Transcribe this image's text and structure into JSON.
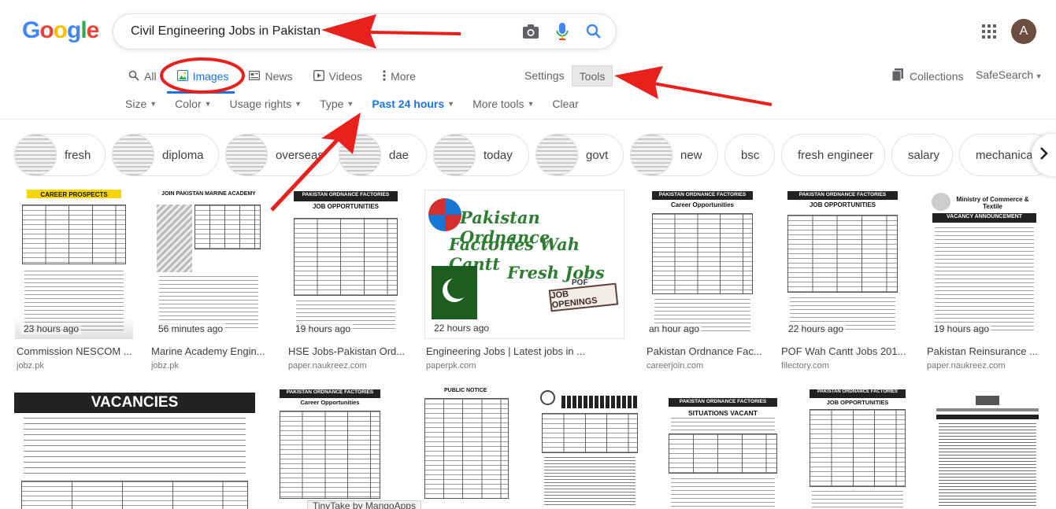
{
  "logo": {
    "letters": [
      "G",
      "o",
      "o",
      "g",
      "l",
      "e"
    ]
  },
  "search": {
    "query": "Civil Engineering Jobs in Pakistan"
  },
  "icons": {
    "camera": "camera-icon",
    "mic": "mic-icon",
    "search": "search-icon",
    "apps": "apps-grid-icon"
  },
  "account": {
    "initial": "A",
    "color": "#6d4c41"
  },
  "tabs": [
    {
      "label": "All",
      "icon": "search-icon"
    },
    {
      "label": "Images",
      "icon": "image-icon"
    },
    {
      "label": "News",
      "icon": "news-icon"
    },
    {
      "label": "Videos",
      "icon": "video-icon"
    },
    {
      "label": "More",
      "icon": "more-vert-icon"
    }
  ],
  "toolbar": {
    "settings": "Settings",
    "tools": "Tools",
    "collections": "Collections",
    "safesearch": "SafeSearch"
  },
  "filters": [
    {
      "label": "Size"
    },
    {
      "label": "Color"
    },
    {
      "label": "Usage rights"
    },
    {
      "label": "Type"
    },
    {
      "label": "Past 24 hours"
    },
    {
      "label": "More tools"
    },
    {
      "label": "Clear"
    }
  ],
  "chips": [
    {
      "label": "fresh"
    },
    {
      "label": "diploma"
    },
    {
      "label": "overseas"
    },
    {
      "label": "dae"
    },
    {
      "label": "today"
    },
    {
      "label": "govt"
    },
    {
      "label": "new"
    },
    {
      "label": "bsc"
    },
    {
      "label": "fresh engineer"
    },
    {
      "label": "salary"
    },
    {
      "label": "mechanical"
    }
  ],
  "results_row1": [
    {
      "time": "23 hours ago",
      "title": "Commission NESCOM ...",
      "source": "jobz.pk",
      "head": "CAREER PROSPECTS"
    },
    {
      "time": "56 minutes ago",
      "title": "Marine Academy Engin...",
      "source": "jobz.pk",
      "head": "JOIN PAKISTAN MARINE ACADEMY"
    },
    {
      "time": "19 hours ago",
      "title": "HSE Jobs-Pakistan Ord...",
      "source": "paper.naukreez.com",
      "head": "PAKISTAN ORDNANCE FACTORIES",
      "sub": "JOB OPPORTUNITIES"
    },
    {
      "time": "22 hours ago",
      "title": "Engineering Jobs | Latest jobs in ...",
      "source": "paperpk.com",
      "overlay": [
        "Pakistan Ordnance",
        "Factories Wah Cantt",
        "Fresh Jobs"
      ],
      "sign": "JOB OPENINGS",
      "pof": "POF"
    },
    {
      "time": "an hour ago",
      "title": "Pakistan Ordnance Fac...",
      "source": "careerjoin.com",
      "head": "PAKISTAN ORDNANCE FACTORIES",
      "sub": "Career Opportunities"
    },
    {
      "time": "22 hours ago",
      "title": "POF Wah Cantt Jobs 201...",
      "source": "filectory.com",
      "head": "PAKISTAN ORDNANCE FACTORIES",
      "sub": "JOB OPPORTUNITIES"
    },
    {
      "time": "19 hours ago",
      "title": "Pakistan Reinsurance ...",
      "source": "paper.naukreez.com",
      "head": "Ministry of Commerce & Textile",
      "sub": "VACANCY ANNOUNCEMENT"
    }
  ],
  "results_row2": [
    {
      "head": "VACANCIES"
    },
    {
      "head": "PAKISTAN ORDNANCE FACTORIES",
      "sub": "Career Opportunities"
    },
    {
      "head": "PUBLIC NOTICE"
    },
    {
      "head": ""
    },
    {
      "head": "PAKISTAN ORDNANCE FACTORIES",
      "sub": "SITUATIONS VACANT"
    },
    {
      "head": "PAKISTAN ORDNANCE FACTORIES",
      "sub": "JOB OPPORTUNITIES"
    },
    {
      "head": ""
    }
  ],
  "overlay_label": "TinyTake by MangoApps",
  "colors": {
    "annotation_red": "#e8211c",
    "link_blue": "#1a73e8",
    "tools_bg": "#e8e8e8"
  }
}
